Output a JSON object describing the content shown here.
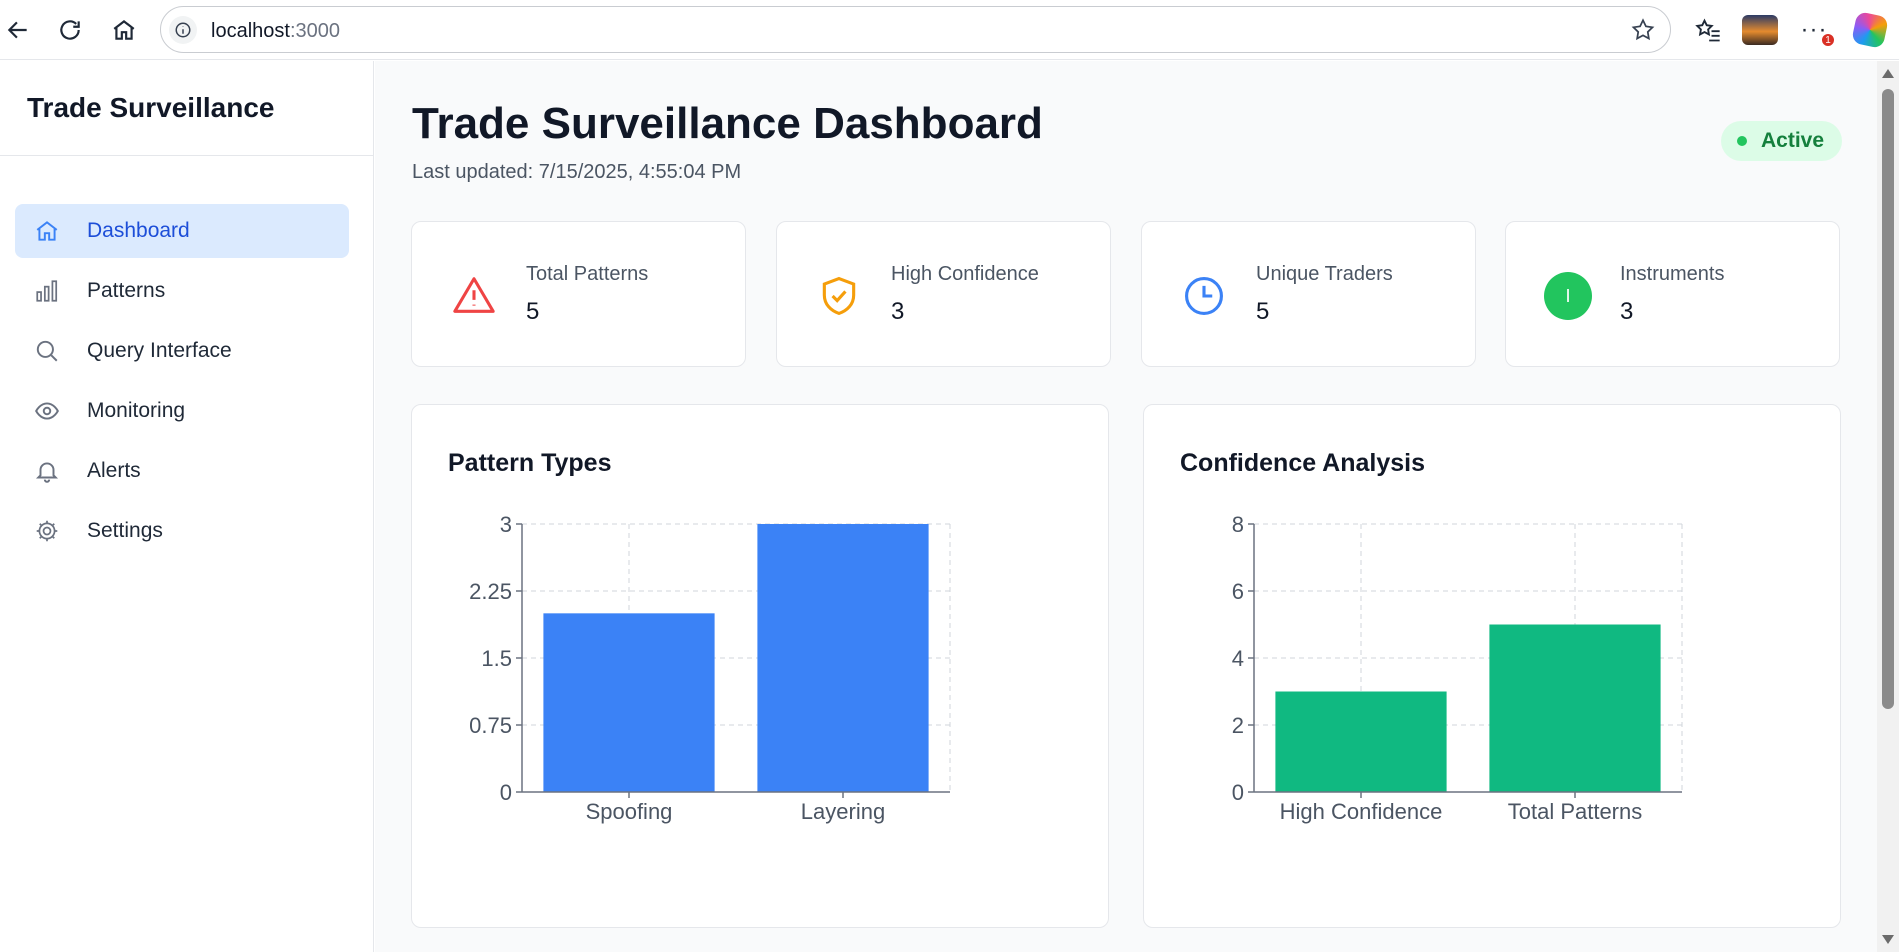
{
  "browser": {
    "url_host": "localhost",
    "url_port": ":3000",
    "notification_count": "1"
  },
  "sidebar": {
    "brand": "Trade Surveillance",
    "items": [
      {
        "label": "Dashboard",
        "icon": "home-icon",
        "active": true
      },
      {
        "label": "Patterns",
        "icon": "bar-chart-icon",
        "active": false
      },
      {
        "label": "Query Interface",
        "icon": "search-icon",
        "active": false
      },
      {
        "label": "Monitoring",
        "icon": "eye-icon",
        "active": false
      },
      {
        "label": "Alerts",
        "icon": "bell-icon",
        "active": false
      },
      {
        "label": "Settings",
        "icon": "gear-icon",
        "active": false
      }
    ]
  },
  "header": {
    "title": "Trade Surveillance Dashboard",
    "last_updated": "Last updated: 7/15/2025, 4:55:04 PM",
    "status": "Active"
  },
  "stats": [
    {
      "label": "Total Patterns",
      "value": "5",
      "icon": "alert-triangle-icon",
      "color": "#ef4444"
    },
    {
      "label": "High Confidence",
      "value": "3",
      "icon": "shield-check-icon",
      "color": "#f59e0b"
    },
    {
      "label": "Unique Traders",
      "value": "5",
      "icon": "clock-icon",
      "color": "#3b82f6"
    },
    {
      "label": "Instruments",
      "value": "3",
      "icon": "instrument-circle-icon",
      "icon_text": "I",
      "color": "#22c55e"
    }
  ],
  "colors": {
    "accent": "#3b82f6",
    "success": "#10b981",
    "active_nav_bg": "#dbeafe"
  },
  "chart_data": [
    {
      "type": "bar",
      "title": "Pattern Types",
      "categories": [
        "Spoofing",
        "Layering"
      ],
      "values": [
        2,
        3
      ],
      "yticks": [
        "0",
        "0.75",
        "1.5",
        "2.25",
        "3"
      ],
      "ylim": [
        0,
        3
      ],
      "grid": true,
      "color": "#3b82f6"
    },
    {
      "type": "bar",
      "title": "Confidence Analysis",
      "categories": [
        "High Confidence",
        "Total Patterns"
      ],
      "values": [
        3,
        5
      ],
      "yticks": [
        "0",
        "2",
        "4",
        "6",
        "8"
      ],
      "ylim": [
        0,
        8
      ],
      "grid": true,
      "color": "#10b981"
    }
  ]
}
